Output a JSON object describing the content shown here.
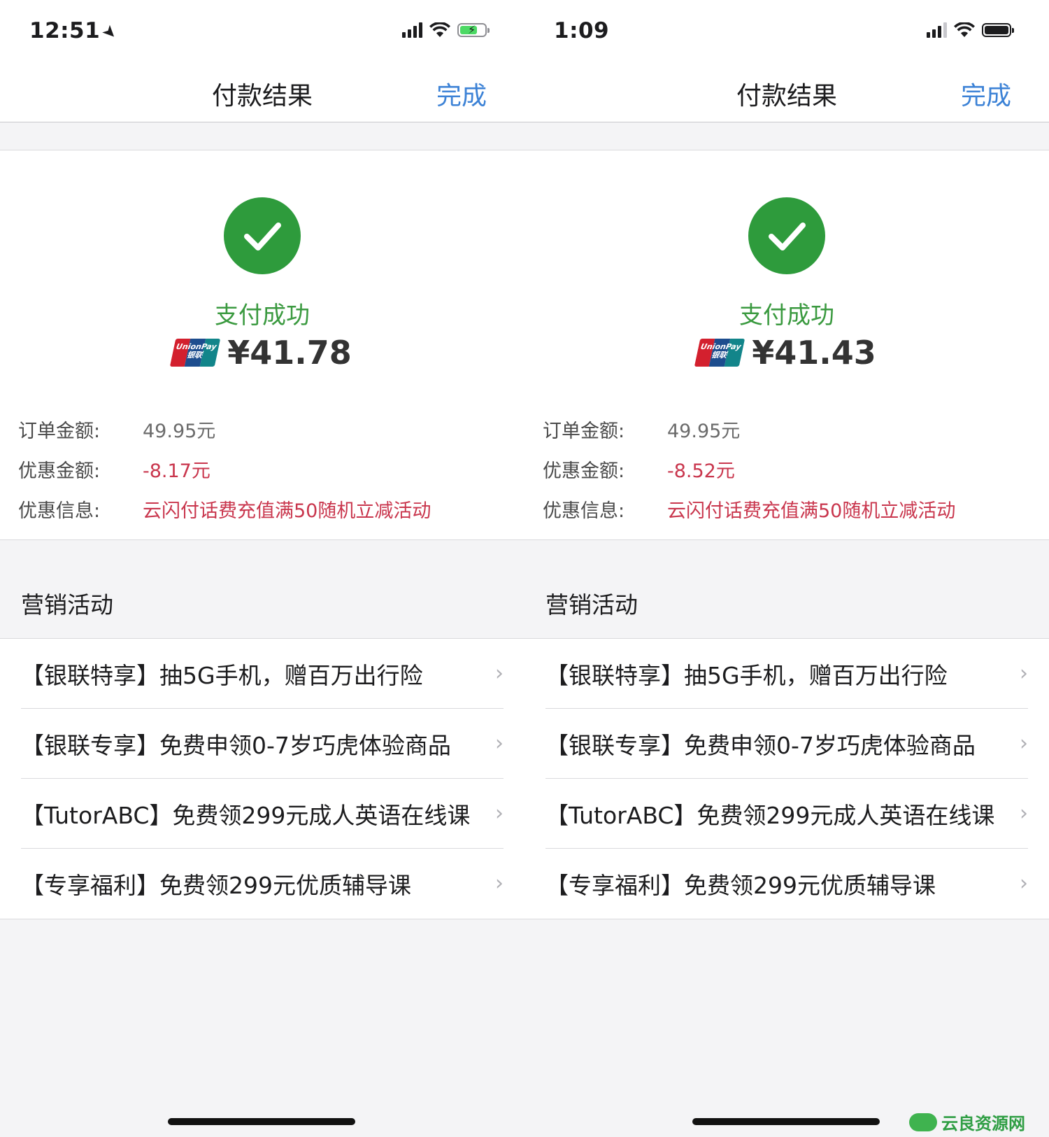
{
  "screens": [
    {
      "status_time": "12:51",
      "nav_title": "付款结果",
      "nav_done": "完成",
      "success_text": "支付成功",
      "amount": "¥41.78",
      "details": [
        {
          "label": "订单金额:",
          "value": "49.95元"
        },
        {
          "label": "优惠金额:",
          "value": "-8.17元"
        },
        {
          "label": "优惠信息:",
          "value": "云闪付话费充值满50随机立减活动"
        }
      ],
      "section_title": "营销活动",
      "items": [
        "【银联特享】抽5G手机，赠百万出行险",
        "【银联专享】免费申领0-7岁巧虎体验商品",
        "【TutorABC】免费领299元成人英语在线课",
        "【专享福利】免费领299元优质辅导课"
      ]
    },
    {
      "status_time": "1:09",
      "nav_title": "付款结果",
      "nav_done": "完成",
      "success_text": "支付成功",
      "amount": "¥41.43",
      "details": [
        {
          "label": "订单金额:",
          "value": "49.95元"
        },
        {
          "label": "优惠金额:",
          "value": "-8.52元"
        },
        {
          "label": "优惠信息:",
          "value": "云闪付话费充值满50随机立减活动"
        }
      ],
      "section_title": "营销活动",
      "items": [
        "【银联特享】抽5G手机，赠百万出行险",
        "【银联专享】免费申领0-7岁巧虎体验商品",
        "【TutorABC】免费领299元成人英语在线课",
        "【专享福利】免费领299元优质辅导课"
      ]
    }
  ],
  "logo_text": "UnionPay 银联",
  "chevron": "›",
  "watermark": "云良资源网",
  "colors": {
    "accent_blue": "#3c82d6",
    "success_green": "#2e9b3c",
    "discount_red": "#c9364d"
  }
}
